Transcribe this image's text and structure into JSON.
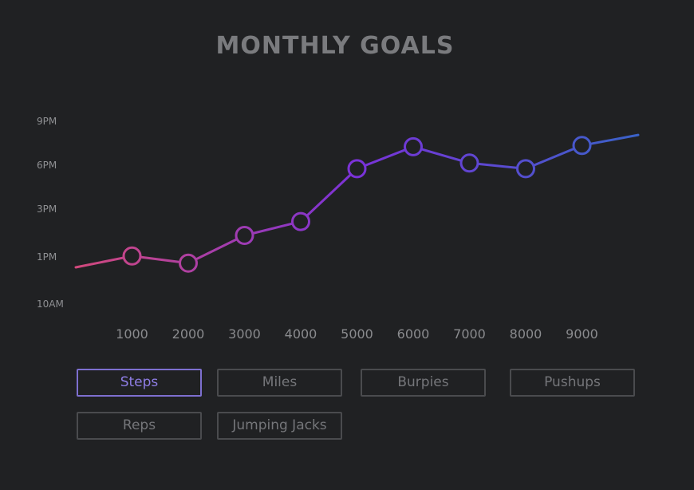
{
  "title": "MONTHLY GOALS",
  "buttons": [
    {
      "label": "Steps",
      "active": true
    },
    {
      "label": "Miles",
      "active": false
    },
    {
      "label": "Burpies",
      "active": false
    },
    {
      "label": "Pushups",
      "active": false
    },
    {
      "label": "Reps",
      "active": false
    },
    {
      "label": "Jumping Jacks",
      "active": false
    }
  ],
  "colors": {
    "background": "#202123",
    "line_start": "#d2497c",
    "line_mid": "#7a32d8",
    "line_end": "#3a62c8",
    "active_button": "#8f7ee6"
  },
  "chart_data": {
    "type": "line",
    "title": "MONTHLY GOALS",
    "x_ticks": [
      "1000",
      "2000",
      "3000",
      "4000",
      "5000",
      "6000",
      "7000",
      "8000",
      "9000"
    ],
    "y_ticks": [
      "10AM",
      "1PM",
      "3PM",
      "6PM",
      "9PM"
    ],
    "y_tick_values": [
      0,
      1,
      2,
      3,
      4
    ],
    "x": [
      0,
      1000,
      2000,
      3000,
      4000,
      5000,
      6000,
      7000,
      8000,
      9000,
      10000
    ],
    "y": [
      0.78,
      1.02,
      0.87,
      1.45,
      1.74,
      2.92,
      3.42,
      3.05,
      2.92,
      3.45,
      3.69
    ],
    "markers": [
      false,
      true,
      true,
      true,
      true,
      true,
      true,
      true,
      true,
      true,
      false
    ],
    "xlim": [
      0,
      10000
    ],
    "ylim": [
      0,
      4
    ],
    "grid": false,
    "legend": "none"
  }
}
